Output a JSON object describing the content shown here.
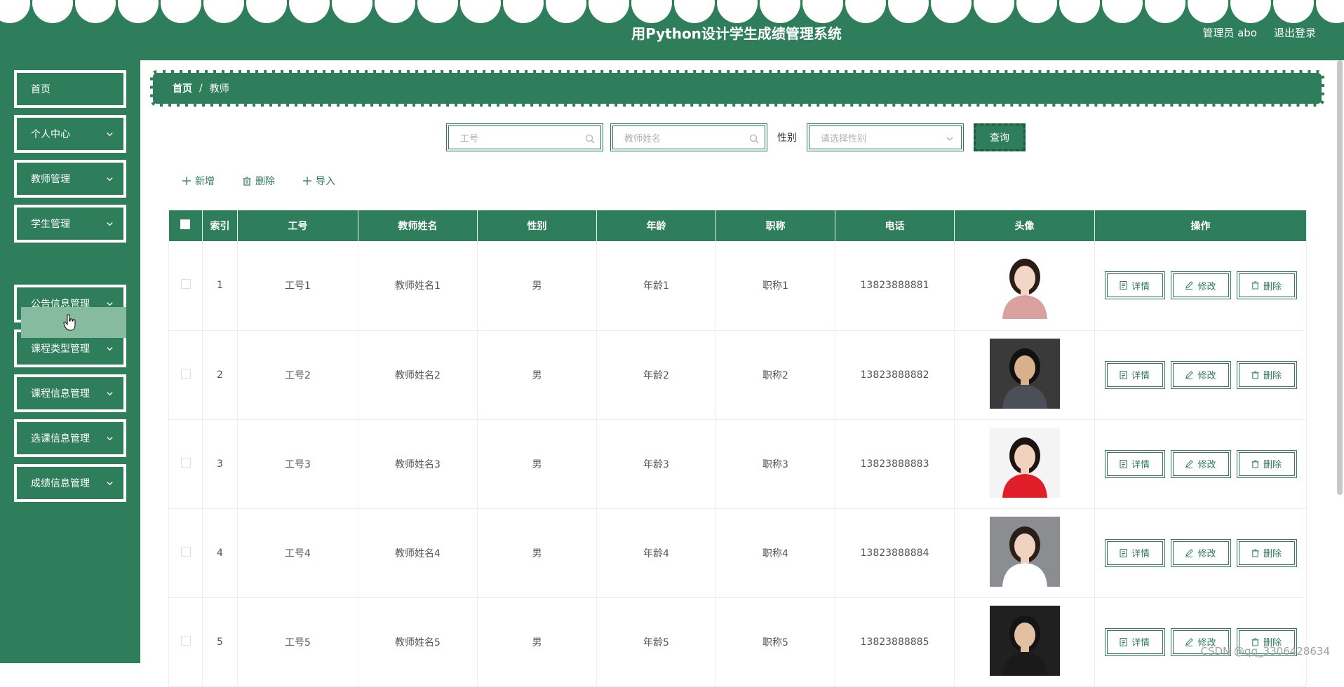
{
  "header": {
    "title": "用Python设计学生成绩管理系统",
    "admin": "管理员 abo",
    "logout": "退出登录"
  },
  "sidebar": {
    "items": [
      {
        "label": "首页",
        "has_chevron": false
      },
      {
        "label": "个人中心",
        "has_chevron": true
      },
      {
        "label": "教师管理",
        "has_chevron": true
      },
      {
        "label": "学生管理",
        "has_chevron": true
      },
      {
        "label": "公告信息管理",
        "has_chevron": true
      },
      {
        "label": "课程类型管理",
        "has_chevron": true
      },
      {
        "label": "课程信息管理",
        "has_chevron": true
      },
      {
        "label": "选课信息管理",
        "has_chevron": true
      },
      {
        "label": "成绩信息管理",
        "has_chevron": true
      }
    ]
  },
  "breadcrumb": {
    "home": "首页",
    "sep": "/",
    "current": "教师"
  },
  "search": {
    "id_placeholder": "工号",
    "name_placeholder": "教师姓名",
    "sex_label": "性别",
    "sex_placeholder": "请选择性别",
    "query_label": "查询"
  },
  "actions": {
    "add": "新增",
    "delete": "删除",
    "import": "导入"
  },
  "table": {
    "headers": [
      "",
      "索引",
      "工号",
      "教师姓名",
      "性别",
      "年龄",
      "职称",
      "电话",
      "头像",
      "操作"
    ],
    "rows": [
      {
        "index": "1",
        "gonghao": "工号1",
        "name": "教师姓名1",
        "sex": "男",
        "age": "年龄1",
        "title": "职称1",
        "phone": "13823888881"
      },
      {
        "index": "2",
        "gonghao": "工号2",
        "name": "教师姓名2",
        "sex": "男",
        "age": "年龄2",
        "title": "职称2",
        "phone": "13823888882"
      },
      {
        "index": "3",
        "gonghao": "工号3",
        "name": "教师姓名3",
        "sex": "男",
        "age": "年龄3",
        "title": "职称3",
        "phone": "13823888883"
      },
      {
        "index": "4",
        "gonghao": "工号4",
        "name": "教师姓名4",
        "sex": "男",
        "age": "年龄4",
        "title": "职称4",
        "phone": "13823888884"
      },
      {
        "index": "5",
        "gonghao": "工号5",
        "name": "教师姓名5",
        "sex": "男",
        "age": "年龄5",
        "title": "职称5",
        "phone": "13823888885"
      }
    ],
    "ops": {
      "detail": "详情",
      "edit": "修改",
      "delete": "删除"
    }
  },
  "watermark": "CSDN @qq_3306428634",
  "colors": {
    "primary": "#2e7d5b",
    "submenu": "#86bb9f"
  }
}
